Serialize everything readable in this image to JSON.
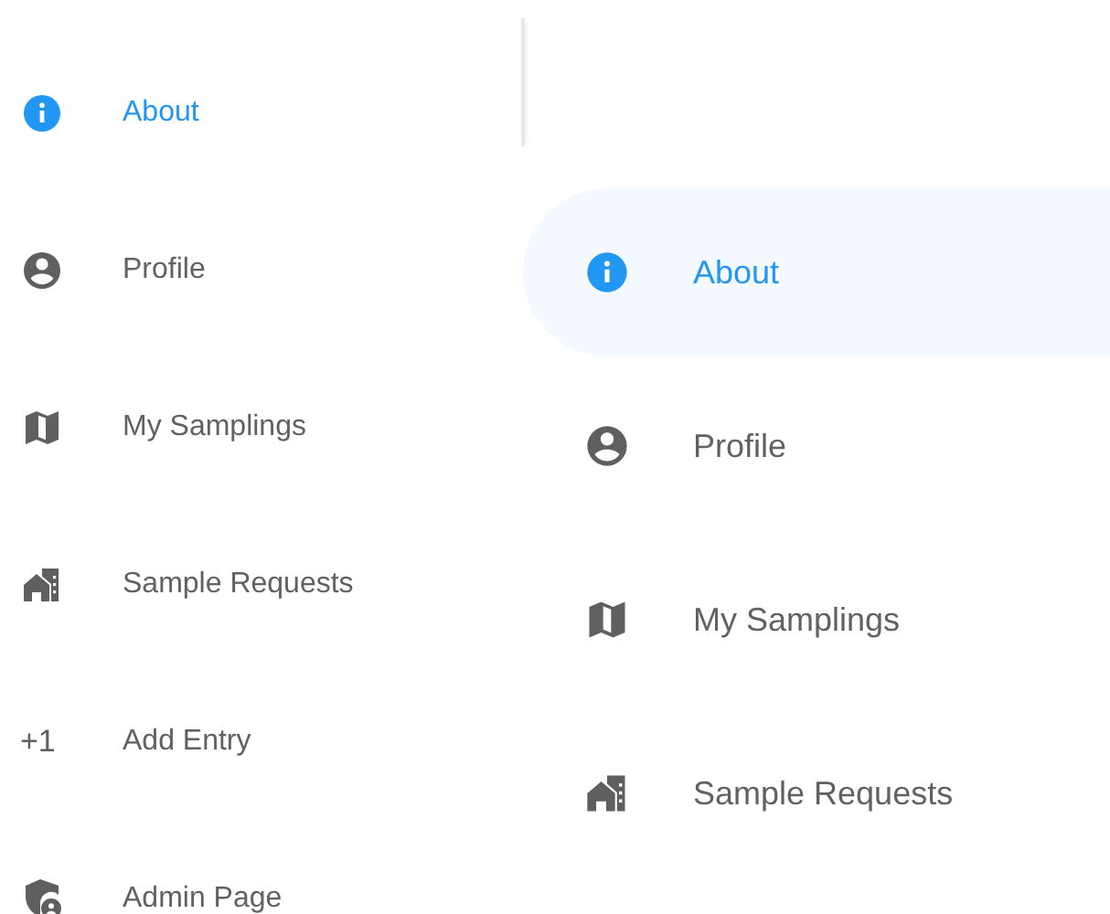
{
  "left_menu": {
    "items": [
      {
        "label": "About",
        "selected": true
      },
      {
        "label": "Profile",
        "selected": false
      },
      {
        "label": "My Samplings",
        "selected": false
      },
      {
        "label": "Sample Requests",
        "selected": false
      },
      {
        "label": "Add Entry",
        "selected": false,
        "glyph": "+1"
      },
      {
        "label": "Admin Page",
        "selected": false
      }
    ]
  },
  "right_menu": {
    "items": [
      {
        "label": "About",
        "selected": true
      },
      {
        "label": "Profile",
        "selected": false
      },
      {
        "label": "My Samplings",
        "selected": false
      },
      {
        "label": "Sample Requests",
        "selected": false
      }
    ]
  }
}
